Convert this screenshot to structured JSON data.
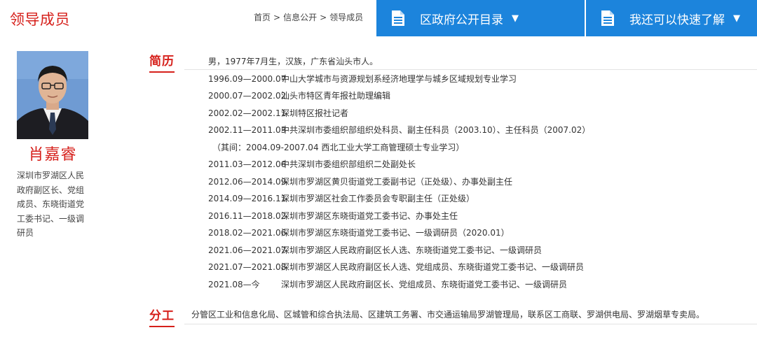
{
  "page": {
    "title": "领导成员"
  },
  "breadcrumb": [
    {
      "label": "首页"
    },
    {
      "label": "信息公开"
    },
    {
      "label": "领导成员"
    }
  ],
  "breadcrumb_separator": ">",
  "nav": {
    "directory": {
      "label": "区政府公开目录",
      "icon": "document-icon",
      "caret": "▼"
    },
    "quick": {
      "label": "我还可以快速了解",
      "icon": "document-icon",
      "caret": "▼"
    }
  },
  "profile": {
    "name": "肖嘉睿",
    "title": "深圳市罗湖区人民政府副区长、党组成员、东晓街道党工委书记、一级调研员"
  },
  "resume": {
    "heading": "简历",
    "intro": "男，1977年7月生，汉族，广东省汕头市人。",
    "entries": [
      {
        "period": "1996.09—2000.07",
        "text": "中山大学城市与资源规划系经济地理学与城乡区域规划专业学习"
      },
      {
        "period": "2000.07—2002.02",
        "text": "汕头市特区青年报社助理编辑"
      },
      {
        "period": "2002.02—2002.11",
        "text": "深圳特区报社记者"
      },
      {
        "period": "2002.11—2011.03",
        "text": "中共深圳市委组织部组织处科员、副主任科员（2003.10）、主任科员（2007.02）"
      },
      {
        "note": "（其间：2004.09-2007.04 西北工业大学工商管理硕士专业学习）"
      },
      {
        "period": "2011.03—2012.06",
        "text": "中共深圳市委组织部组织二处副处长"
      },
      {
        "period": "2012.06—2014.09",
        "text": "深圳市罗湖区黄贝街道党工委副书记（正处级）、办事处副主任"
      },
      {
        "period": "2014.09—2016.11",
        "text": "深圳市罗湖区社会工作委员会专职副主任（正处级）"
      },
      {
        "period": "2016.11—2018.02",
        "text": "深圳市罗湖区东晓街道党工委书记、办事处主任"
      },
      {
        "period": "2018.02—2021.06",
        "text": "深圳市罗湖区东晓街道党工委书记、一级调研员（2020.01）"
      },
      {
        "period": "2021.06—2021.07",
        "text": "深圳市罗湖区人民政府副区长人选、东晓街道党工委书记、一级调研员"
      },
      {
        "period": "2021.07—2021.08",
        "text": "深圳市罗湖区人民政府副区长人选、党组成员、东晓街道党工委书记、一级调研员"
      },
      {
        "period": "2021.08—今",
        "text": "深圳市罗湖区人民政府副区长、党组成员、东晓街道党工委书记、一级调研员"
      }
    ]
  },
  "duty": {
    "heading": "分工",
    "text": "分管区工业和信息化局、区城管和综合执法局、区建筑工务署、市交通运输局罗湖管理局，联系区工商联、罗湖供电局、罗湖烟草专卖局。"
  },
  "colors": {
    "accent_red": "#d6201b",
    "nav_blue": "#1c84dc"
  }
}
